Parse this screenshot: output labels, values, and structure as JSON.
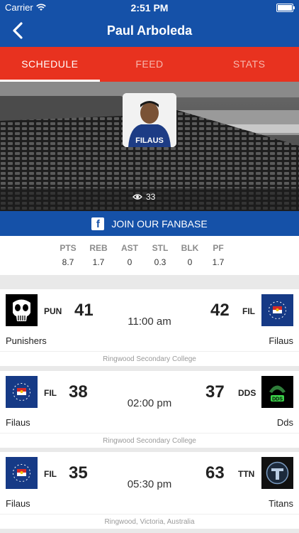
{
  "status": {
    "carrier": "Carrier",
    "time": "2:51 PM"
  },
  "nav": {
    "title": "Paul Arboleda"
  },
  "tabs": [
    "SCHEDULE",
    "FEED",
    "STATS"
  ],
  "profile": {
    "views": "33",
    "jersey_text": "FILAUS"
  },
  "fanbase": {
    "label": "JOIN OUR FANBASE"
  },
  "stats": {
    "labels": [
      "PTS",
      "REB",
      "AST",
      "STL",
      "BLK",
      "PF"
    ],
    "values": [
      "8.7",
      "1.7",
      "0",
      "0.3",
      "0",
      "1.7"
    ]
  },
  "games": [
    {
      "left": {
        "abbr": "PUN",
        "score": "41",
        "name": "Punishers",
        "logo": "punisher-logo"
      },
      "time": "11:00 am",
      "right": {
        "abbr": "FIL",
        "score": "42",
        "name": "Filaus",
        "logo": "filaus-logo"
      },
      "venue": "Ringwood Secondary College"
    },
    {
      "left": {
        "abbr": "FIL",
        "score": "38",
        "name": "Filaus",
        "logo": "filaus-logo"
      },
      "time": "02:00 pm",
      "right": {
        "abbr": "DDS",
        "score": "37",
        "name": "Dds",
        "logo": "dds-logo"
      },
      "venue": "Ringwood Secondary College"
    },
    {
      "left": {
        "abbr": "FIL",
        "score": "35",
        "name": "Filaus",
        "logo": "filaus-logo"
      },
      "time": "05:30 pm",
      "right": {
        "abbr": "TTN",
        "score": "63",
        "name": "Titans",
        "logo": "titans-logo"
      },
      "venue": "Ringwood, Victoria, Australia"
    }
  ],
  "dds_logo_text": "DDS"
}
